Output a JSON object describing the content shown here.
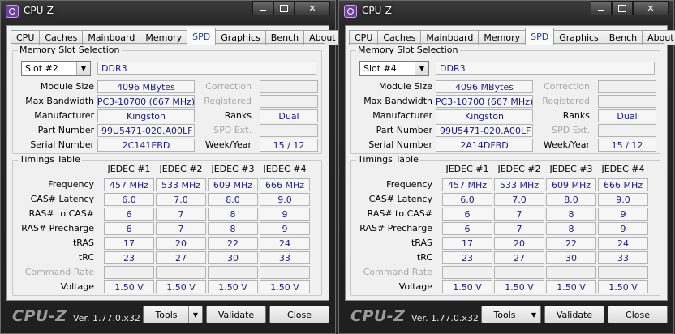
{
  "windows": [
    {
      "title": "CPU-Z",
      "tabs": [
        "CPU",
        "Caches",
        "Mainboard",
        "Memory",
        "SPD",
        "Graphics",
        "Bench",
        "About"
      ],
      "active_tab": "SPD",
      "memory_slot_group": "Memory Slot Selection",
      "slot": "Slot #2",
      "memory_type": "DDR3",
      "module_size_label": "Module Size",
      "module_size": "4096 MBytes",
      "max_bandwidth_label": "Max Bandwidth",
      "max_bandwidth": "PC3-10700 (667 MHz)",
      "manufacturer_label": "Manufacturer",
      "manufacturer": "Kingston",
      "part_number_label": "Part Number",
      "part_number": "99U5471-020.A00LF",
      "serial_number_label": "Serial Number",
      "serial_number": "2C141EBD",
      "correction_label": "Correction",
      "registered_label": "Registered",
      "ranks_label": "Ranks",
      "ranks": "Dual",
      "spd_ext_label": "SPD Ext.",
      "week_year_label": "Week/Year",
      "week_year": "15 / 12",
      "timings_group": "Timings Table",
      "timing_columns": [
        "JEDEC #1",
        "JEDEC #2",
        "JEDEC #3",
        "JEDEC #4"
      ],
      "timing_rows": [
        {
          "label": "Frequency",
          "values": [
            "457 MHz",
            "533 MHz",
            "609 MHz",
            "666 MHz"
          ]
        },
        {
          "label": "CAS# Latency",
          "values": [
            "6.0",
            "7.0",
            "8.0",
            "9.0"
          ]
        },
        {
          "label": "RAS# to CAS#",
          "values": [
            "6",
            "7",
            "8",
            "9"
          ]
        },
        {
          "label": "RAS# Precharge",
          "values": [
            "6",
            "7",
            "8",
            "9"
          ]
        },
        {
          "label": "tRAS",
          "values": [
            "17",
            "20",
            "22",
            "24"
          ]
        },
        {
          "label": "tRC",
          "values": [
            "23",
            "27",
            "30",
            "33"
          ]
        },
        {
          "label": "Command Rate",
          "values": [
            "",
            "",
            "",
            ""
          ],
          "disabled": true
        },
        {
          "label": "Voltage",
          "values": [
            "1.50 V",
            "1.50 V",
            "1.50 V",
            "1.50 V"
          ]
        }
      ],
      "footer": {
        "brand": "CPU-Z",
        "version": "Ver. 1.77.0.x32",
        "tools": "Tools",
        "validate": "Validate",
        "close": "Close"
      }
    },
    {
      "title": "CPU-Z",
      "tabs": [
        "CPU",
        "Caches",
        "Mainboard",
        "Memory",
        "SPD",
        "Graphics",
        "Bench",
        "About"
      ],
      "active_tab": "SPD",
      "memory_slot_group": "Memory Slot Selection",
      "slot": "Slot #4",
      "memory_type": "DDR3",
      "module_size_label": "Module Size",
      "module_size": "4096 MBytes",
      "max_bandwidth_label": "Max Bandwidth",
      "max_bandwidth": "PC3-10700 (667 MHz)",
      "manufacturer_label": "Manufacturer",
      "manufacturer": "Kingston",
      "part_number_label": "Part Number",
      "part_number": "99U5471-020.A00LF",
      "serial_number_label": "Serial Number",
      "serial_number": "2A14DFBD",
      "correction_label": "Correction",
      "registered_label": "Registered",
      "ranks_label": "Ranks",
      "ranks": "Dual",
      "spd_ext_label": "SPD Ext.",
      "week_year_label": "Week/Year",
      "week_year": "15 / 12",
      "timings_group": "Timings Table",
      "timing_columns": [
        "JEDEC #1",
        "JEDEC #2",
        "JEDEC #3",
        "JEDEC #4"
      ],
      "timing_rows": [
        {
          "label": "Frequency",
          "values": [
            "457 MHz",
            "533 MHz",
            "609 MHz",
            "666 MHz"
          ]
        },
        {
          "label": "CAS# Latency",
          "values": [
            "6.0",
            "7.0",
            "8.0",
            "9.0"
          ]
        },
        {
          "label": "RAS# to CAS#",
          "values": [
            "6",
            "7",
            "8",
            "9"
          ]
        },
        {
          "label": "RAS# Precharge",
          "values": [
            "6",
            "7",
            "8",
            "9"
          ]
        },
        {
          "label": "tRAS",
          "values": [
            "17",
            "20",
            "22",
            "24"
          ]
        },
        {
          "label": "tRC",
          "values": [
            "23",
            "27",
            "30",
            "33"
          ]
        },
        {
          "label": "Command Rate",
          "values": [
            "",
            "",
            "",
            ""
          ],
          "disabled": true
        },
        {
          "label": "Voltage",
          "values": [
            "1.50 V",
            "1.50 V",
            "1.50 V",
            "1.50 V"
          ]
        }
      ],
      "footer": {
        "brand": "CPU-Z",
        "version": "Ver. 1.77.0.x32",
        "tools": "Tools",
        "validate": "Validate",
        "close": "Close"
      }
    }
  ]
}
